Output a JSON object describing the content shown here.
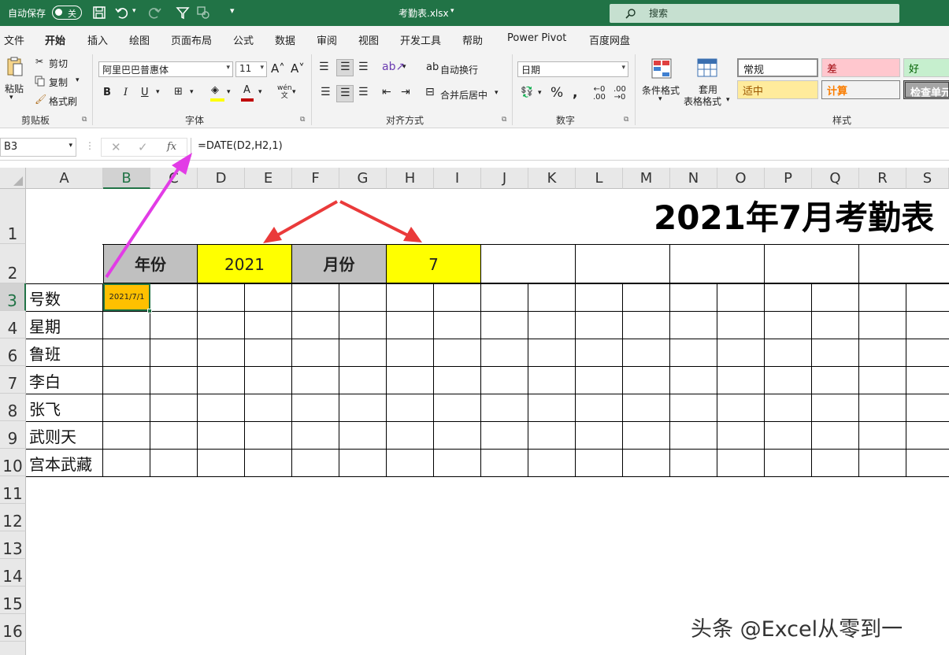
{
  "title_bar": {
    "autosave_label": "自动保存",
    "autosave_state": "关",
    "file_name": "考勤表.xlsx",
    "search_placeholder": "搜索",
    "accent_color": "#217346"
  },
  "menu": {
    "tabs": [
      "文件",
      "开始",
      "插入",
      "绘图",
      "页面布局",
      "公式",
      "数据",
      "审阅",
      "视图",
      "开发工具",
      "帮助",
      "Power Pivot",
      "百度网盘"
    ],
    "active": "开始"
  },
  "ribbon": {
    "clipboard": {
      "paste": "粘贴",
      "cut": "剪切",
      "copy": "复制",
      "format_painter": "格式刷",
      "group_label": "剪贴板"
    },
    "font": {
      "font_name": "阿里巴巴普惠体",
      "font_size": "11",
      "group_label": "字体"
    },
    "alignment": {
      "wrap_text": "自动换行",
      "merge_center": "合并后居中",
      "group_label": "对齐方式"
    },
    "number": {
      "format": "日期",
      "group_label": "数字"
    },
    "styles": {
      "conditional_format": "条件格式",
      "table_format_1": "套用",
      "table_format_2": "表格格式",
      "group_label": "样式",
      "boxes": {
        "normal": "常规",
        "bad": "差",
        "good": "好",
        "neutral": "适中",
        "calc": "计算",
        "check": "检查单元"
      }
    }
  },
  "formula_bar": {
    "name_box": "B3",
    "formula": "=DATE(D2,H2,1)"
  },
  "grid": {
    "columns": [
      "A",
      "B",
      "C",
      "D",
      "E",
      "F",
      "G",
      "H",
      "I",
      "J",
      "K",
      "L",
      "M",
      "N",
      "O",
      "P",
      "Q",
      "R",
      "S"
    ],
    "rows": [
      "1",
      "2",
      "3",
      "4",
      "6",
      "7",
      "8",
      "9",
      "10",
      "11",
      "12",
      "13",
      "14",
      "15",
      "16"
    ],
    "selected_cell": "B3"
  },
  "sheet": {
    "title": "2021年7月考勤表",
    "year_label": "年份",
    "year_value": "2021",
    "month_label": "月份",
    "month_value": "7",
    "b3_value": "2021/7/1",
    "row_labels": [
      "号数",
      "星期",
      "鲁班",
      "李白",
      "张飞",
      "武则天",
      "宫本武藏"
    ]
  },
  "watermark": "头条 @Excel从零到一"
}
